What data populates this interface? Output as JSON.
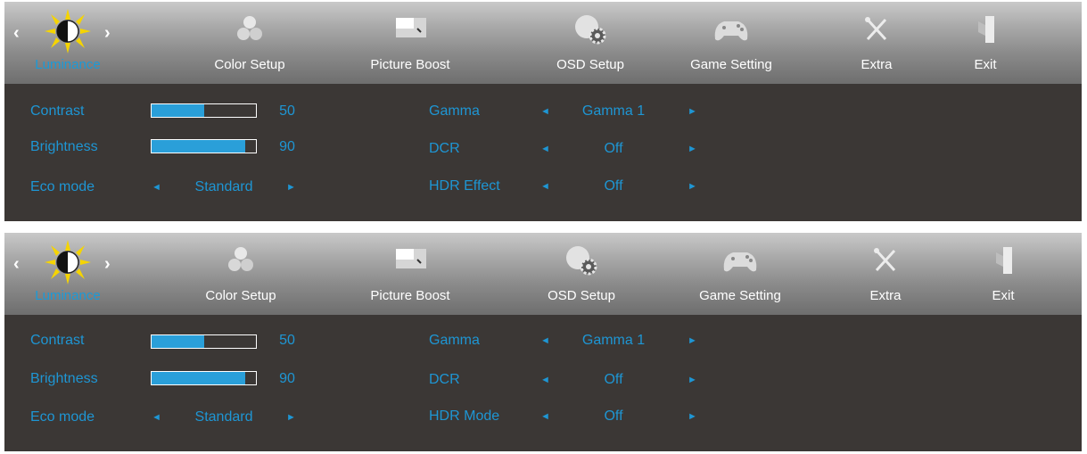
{
  "colors": {
    "accent": "#1e96d4",
    "panel_bg": "#3b3735",
    "bar_fill": "#2a9fd9",
    "sun": "#f5d400"
  },
  "panels": [
    {
      "tabs": [
        {
          "label": "Luminance",
          "icon": "sun-contrast-icon"
        },
        {
          "label": "Color Setup",
          "icon": "color-circles-icon"
        },
        {
          "label": "Picture Boost",
          "icon": "picture-boost-icon"
        },
        {
          "label": "OSD Setup",
          "icon": "osd-gear-globe-icon"
        },
        {
          "label": "Game Setting",
          "icon": "gamepad-icon"
        },
        {
          "label": "Extra",
          "icon": "tools-icon"
        },
        {
          "label": "Exit",
          "icon": "exit-door-icon"
        }
      ],
      "left": {
        "contrast": {
          "label": "Contrast",
          "value": "50",
          "level": 0.5
        },
        "brightness": {
          "label": "Brightness",
          "value": "90",
          "level": 0.9
        },
        "eco": {
          "label": "Eco mode",
          "value": "Standard"
        }
      },
      "right": {
        "gamma": {
          "label": "Gamma",
          "value": "Gamma 1"
        },
        "dcr": {
          "label": "DCR",
          "value": "Off"
        },
        "hdr": {
          "label": "HDR Effect",
          "value": "Off"
        }
      }
    },
    {
      "tabs": [
        {
          "label": "Luminance",
          "icon": "sun-contrast-icon"
        },
        {
          "label": "Color Setup",
          "icon": "color-circles-icon"
        },
        {
          "label": "Picture Boost",
          "icon": "picture-boost-icon"
        },
        {
          "label": "OSD Setup",
          "icon": "osd-gear-globe-icon"
        },
        {
          "label": "Game Setting",
          "icon": "gamepad-icon"
        },
        {
          "label": "Extra",
          "icon": "tools-icon"
        },
        {
          "label": "Exit",
          "icon": "exit-door-icon"
        }
      ],
      "left": {
        "contrast": {
          "label": "Contrast",
          "value": "50",
          "level": 0.5
        },
        "brightness": {
          "label": "Brightness",
          "value": "90",
          "level": 0.9
        },
        "eco": {
          "label": "Eco mode",
          "value": "Standard"
        }
      },
      "right": {
        "gamma": {
          "label": "Gamma",
          "value": "Gamma 1"
        },
        "dcr": {
          "label": "DCR",
          "value": "Off"
        },
        "hdr": {
          "label": "HDR Mode",
          "value": "Off"
        }
      }
    }
  ]
}
